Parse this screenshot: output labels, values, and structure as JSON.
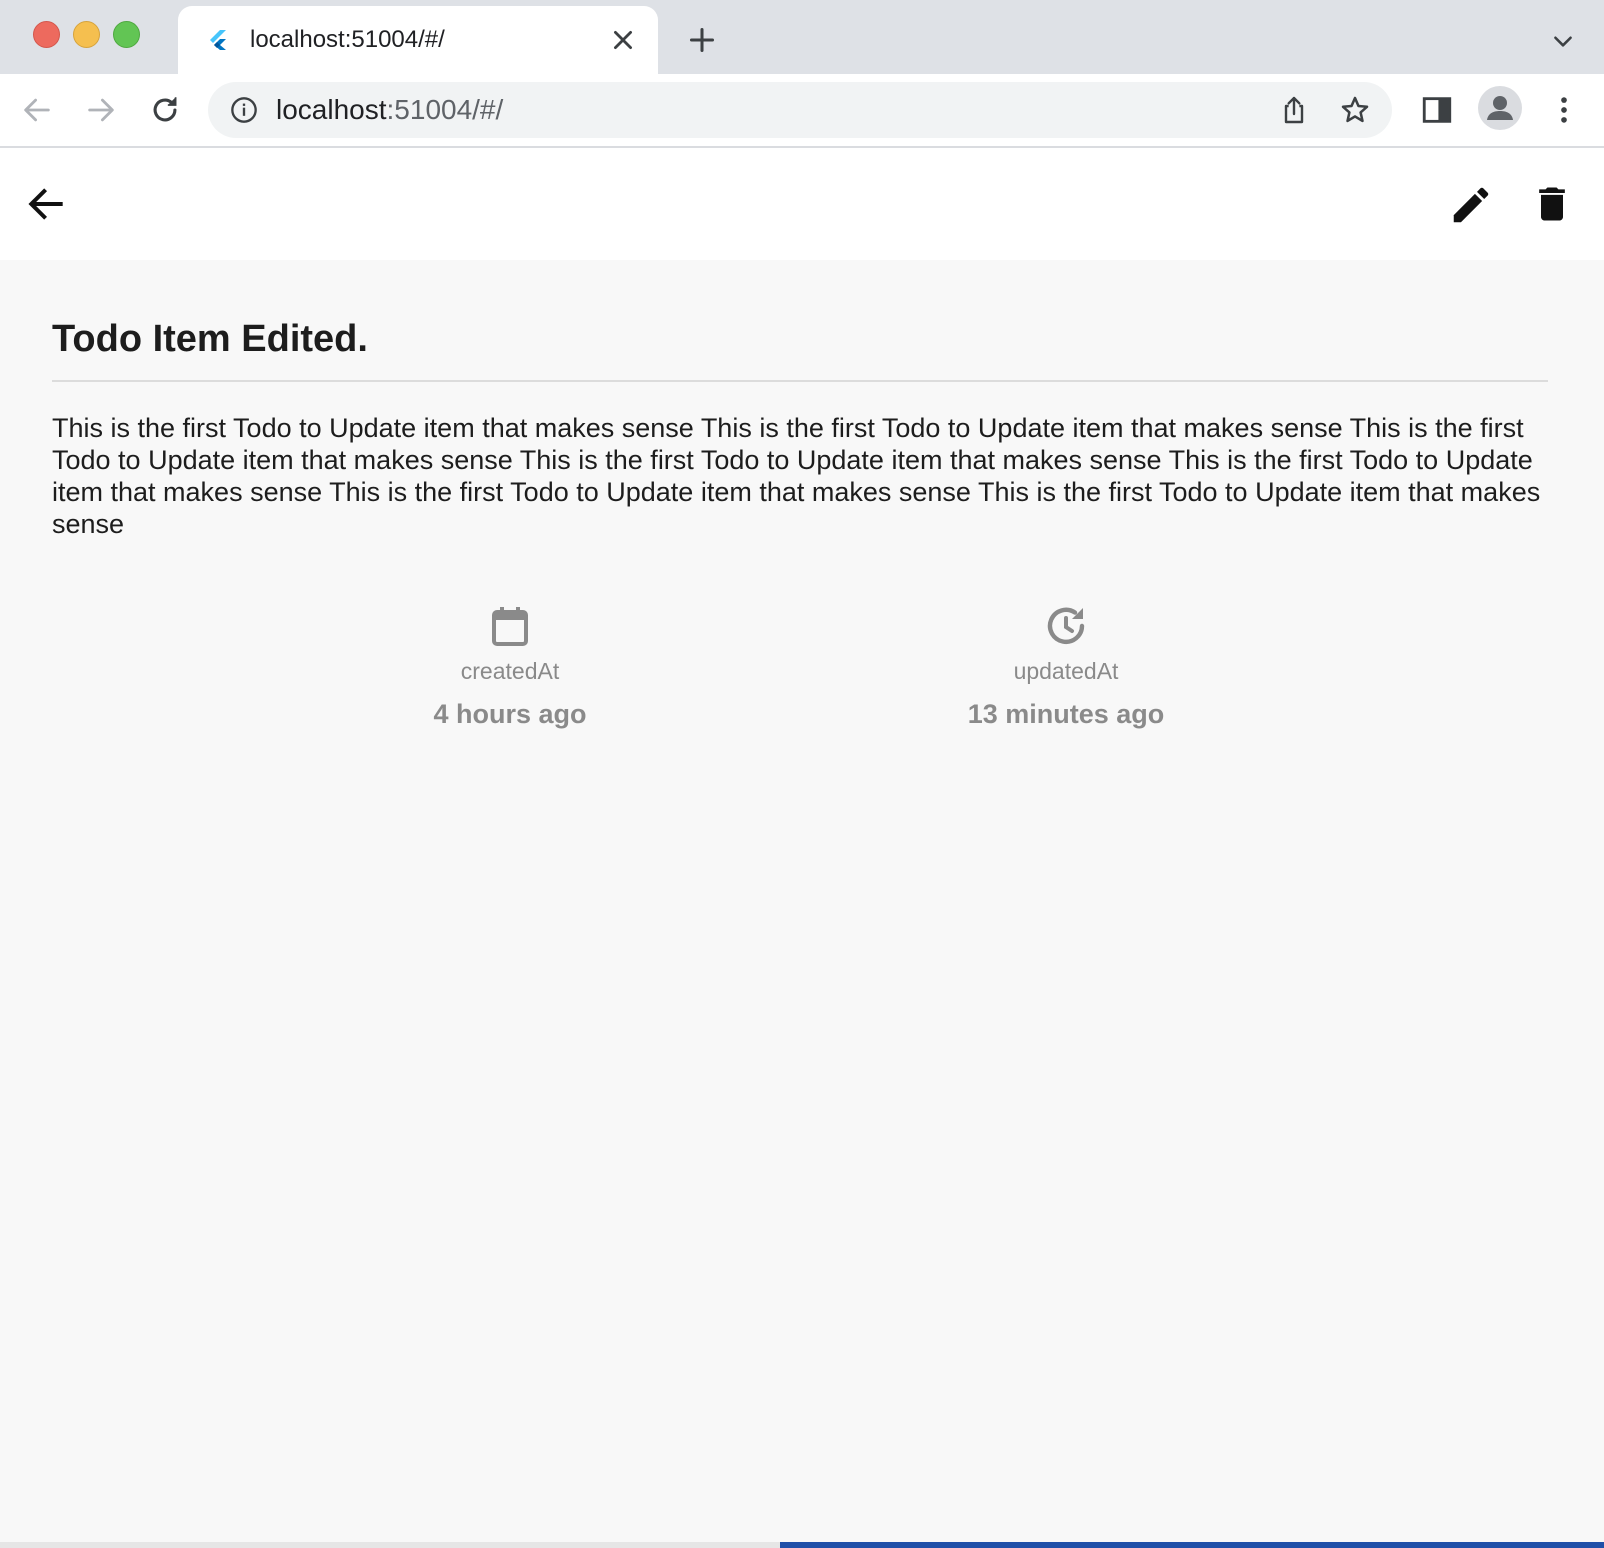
{
  "browser": {
    "tab_title": "localhost:51004/#/",
    "url_host": "localhost",
    "url_rest": ":51004/#/"
  },
  "todo": {
    "title": "Todo Item Edited.",
    "description": "This is the first Todo to Update item that makes sense This is the first Todo to Update item that makes sense This is the first Todo to Update item that makes sense This is the first Todo to Update item that makes sense This is the first Todo to Update item that makes sense This is the first Todo to Update item that makes sense This is the first Todo to Update item that makes sense",
    "created": {
      "label": "createdAt",
      "value": "4 hours ago",
      "icon": "calendar-icon"
    },
    "updated": {
      "label": "updatedAt",
      "value": "13 minutes ago",
      "icon": "update-clock-icon"
    }
  },
  "colors": {
    "meta_gray": "#8a8a8a",
    "page_background": "#f8f8f8",
    "app_bar": "#ffffff"
  }
}
